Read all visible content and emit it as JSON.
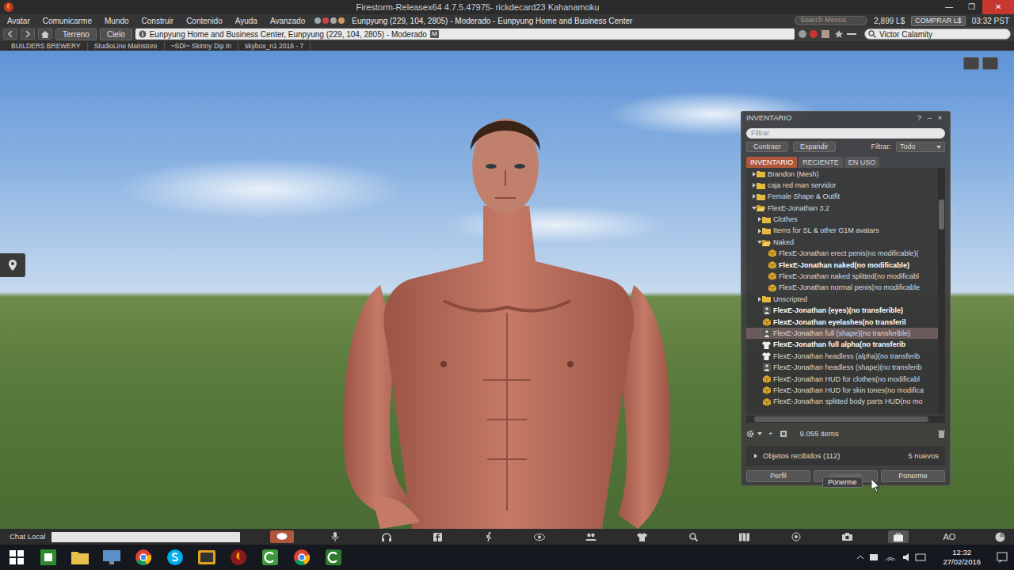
{
  "window": {
    "title": "Firestorm-Releasex64 4.7.5.47975- rickdecard23 Kahanamoku",
    "controls": [
      "—",
      "❐",
      "✕"
    ]
  },
  "menu": {
    "items": [
      "Avatar",
      "Comunicarme",
      "Mundo",
      "Construir",
      "Contenido",
      "Ayuda",
      "Avanzado"
    ],
    "location": "Eunpyung (229, 104, 2805) - Moderado - Eunpyung Home and Business Center",
    "search_placeholder": "Search Menus",
    "balance": "2,899 L$",
    "buy": "COMPRAR L$",
    "time": "03:32 PST"
  },
  "navbar": {
    "buttons": [
      "Terreno",
      "Cielo"
    ],
    "address": "Eunpyung Home and Business Center, Eunpyung (229, 104, 2805) - Moderado",
    "rating": "M",
    "search": "Victor Calamity"
  },
  "favorites": [
    "BUILDERS BREWERY",
    "StudioLine Mainstore",
    "~SDI~ Skinny Dip In",
    "skybox_n1 2016 - 7"
  ],
  "inventory": {
    "title": "INVENTARIO",
    "controls": [
      "?",
      "–",
      "×"
    ],
    "filter_placeholder": "Filtrar",
    "actions": [
      "Contraer",
      "Expandir"
    ],
    "filter_label": "Filtrar:",
    "filter_value": "Todo",
    "tabs": [
      {
        "label": "INVENTARIO",
        "selected": true
      },
      {
        "label": "RECIENTE",
        "selected": false
      },
      {
        "label": "EN USO",
        "selected": false
      }
    ],
    "items": [
      {
        "label": "Brandon (Mesh)",
        "level": 0,
        "kind": "folder",
        "expanded": false,
        "worn": false,
        "selected": false
      },
      {
        "label": "caja red man servidor",
        "level": 0,
        "kind": "folder",
        "expanded": false,
        "worn": false,
        "selected": false
      },
      {
        "label": "Female Shape & Outfit",
        "level": 0,
        "kind": "folder",
        "expanded": false,
        "worn": false,
        "selected": false
      },
      {
        "label": "FlexE-Jonathan 3.2",
        "level": 0,
        "kind": "folder",
        "expanded": true,
        "worn": false,
        "selected": false
      },
      {
        "label": "Clothes",
        "level": 1,
        "kind": "folder",
        "expanded": false,
        "worn": false,
        "selected": false
      },
      {
        "label": "Items for SL & other G1M avatars",
        "level": 1,
        "kind": "folder",
        "expanded": false,
        "worn": false,
        "selected": false
      },
      {
        "label": "Naked",
        "level": 1,
        "kind": "folder",
        "expanded": true,
        "worn": false,
        "selected": false
      },
      {
        "label": "FlexE-Jonathan erect penis(no modificable)(",
        "level": 2,
        "kind": "object",
        "expanded": false,
        "worn": false,
        "selected": false
      },
      {
        "label": "FlexE-Jonathan naked(no modificable)",
        "level": 2,
        "kind": "object",
        "expanded": false,
        "worn": true,
        "selected": false
      },
      {
        "label": "FlexE-Jonathan naked splitted(no modificabl",
        "level": 2,
        "kind": "object",
        "expanded": false,
        "worn": false,
        "selected": false
      },
      {
        "label": "FlexE-Jonathan normal penis(no modificable",
        "level": 2,
        "kind": "object",
        "expanded": false,
        "worn": false,
        "selected": false
      },
      {
        "label": "Unscripted",
        "level": 1,
        "kind": "folder",
        "expanded": false,
        "worn": false,
        "selected": false
      },
      {
        "label": "FlexE-Jonathan (eyes)(no transferible)",
        "level": 1,
        "kind": "bodypart",
        "expanded": false,
        "worn": true,
        "selected": false
      },
      {
        "label": "FlexE-Jonathan eyelashes(no transferil",
        "level": 1,
        "kind": "object",
        "expanded": false,
        "worn": true,
        "selected": false
      },
      {
        "label": "FlexE-Jonathan full (shape)(no transferible)",
        "level": 1,
        "kind": "bodypart",
        "expanded": false,
        "worn": false,
        "selected": true
      },
      {
        "label": "FlexE-Jonathan full alpha(no transferib",
        "level": 1,
        "kind": "clothing",
        "expanded": false,
        "worn": true,
        "selected": false
      },
      {
        "label": "FlexE-Jonathan headless (alpha)(no transferib",
        "level": 1,
        "kind": "clothing",
        "expanded": false,
        "worn": false,
        "selected": false
      },
      {
        "label": "FlexE-Jonathan headless (shape)(no transferib",
        "level": 1,
        "kind": "bodypart",
        "expanded": false,
        "worn": false,
        "selected": false
      },
      {
        "label": "FlexE-Jonathan HUD for clothes(no modificabl",
        "level": 1,
        "kind": "object",
        "expanded": false,
        "worn": false,
        "selected": false
      },
      {
        "label": "FlexE-Jonathan HUD for skin tones(no modifica",
        "level": 1,
        "kind": "object",
        "expanded": false,
        "worn": false,
        "selected": false
      },
      {
        "label": "FlexE-Jonathan splitted body parts HUD(no mo",
        "level": 1,
        "kind": "object",
        "expanded": false,
        "worn": false,
        "selected": false
      }
    ],
    "add": "+",
    "count": "9.055 items",
    "received": {
      "label": "Objetos recibidos (112)",
      "new": "5 nuevos",
      "expanded": false
    },
    "buttons": [
      {
        "label": "Perfil",
        "disabled": false
      },
      {
        "label": "Compartir",
        "disabled": true
      },
      {
        "label": "Ponerme",
        "disabled": false
      }
    ]
  },
  "tooltip": "Ponerme",
  "toolbar": {
    "chat_label": "Chat Local",
    "ao": "AO"
  },
  "taskbar": {
    "time": "12:32",
    "date": "27/02/2016"
  }
}
